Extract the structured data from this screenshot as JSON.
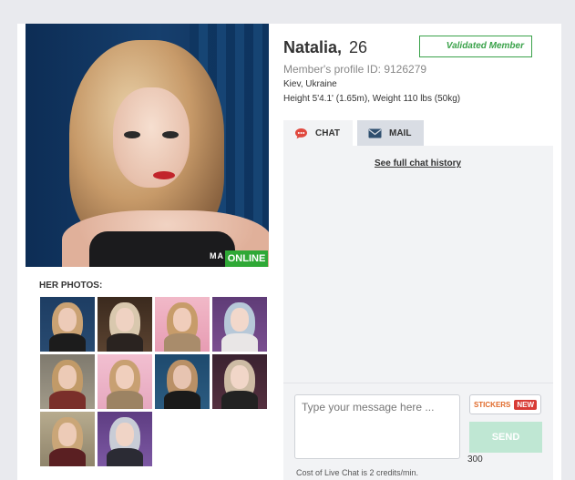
{
  "profile": {
    "name": "Natalia,",
    "age": "26",
    "validated_label": "Validated Member",
    "profile_id": "Member's profile ID: 9126279",
    "location": "Kiev, Ukraine",
    "stats": "Height 5'4.1' (1.65m), Weight 110 lbs (50kg)",
    "status_badge": "ONLINE",
    "photo_watermark": "MA",
    "colors": {
      "online": "#2fa836",
      "validated": "#3aa24a",
      "new_badge": "#d83b35",
      "stickers": "#e06a2a",
      "send_disabled": "#bfe7d3"
    }
  },
  "photos": {
    "label": "HER PHOTOS:",
    "count": 10
  },
  "tabs": [
    {
      "label": "CHAT",
      "icon": "chat-bubble-icon",
      "active": true
    },
    {
      "label": "MAIL",
      "icon": "envelope-icon",
      "active": false
    }
  ],
  "chat": {
    "history_link": "See full chat history",
    "input_placeholder": "Type your message here ...",
    "stickers_label": "STICKERS",
    "new_badge": "NEW",
    "send_label": "SEND",
    "char_count": "300",
    "cost_note": "Cost of Live Chat is 2 credits/min."
  }
}
